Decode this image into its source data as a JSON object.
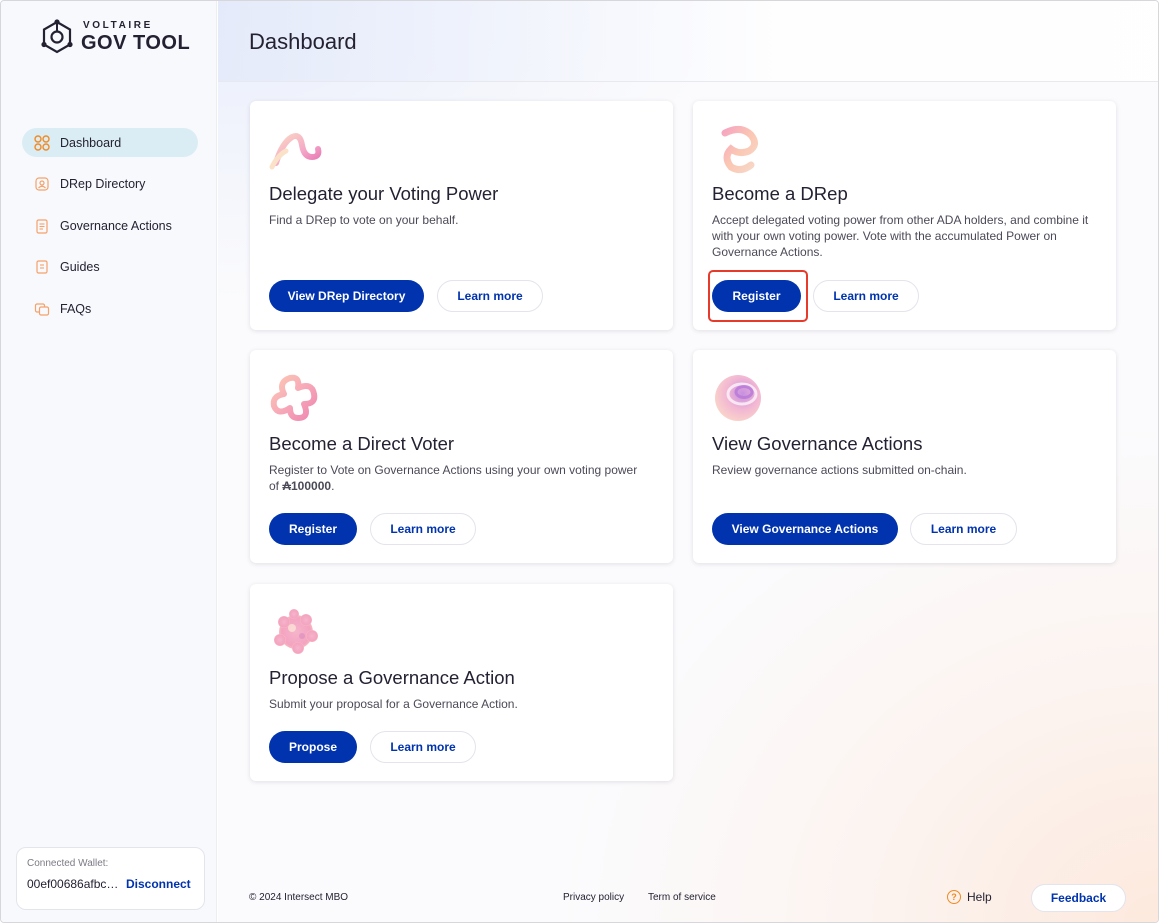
{
  "logo": {
    "small": "VOLTAIRE",
    "big": "GOV TOOL"
  },
  "sidebar": {
    "items": [
      {
        "label": "Dashboard",
        "icon": "dashboard-grid-icon",
        "active": true
      },
      {
        "label": "DRep Directory",
        "icon": "drep-directory-icon",
        "active": false
      },
      {
        "label": "Governance Actions",
        "icon": "governance-actions-icon",
        "active": false
      },
      {
        "label": "Guides",
        "icon": "guides-icon",
        "active": false
      },
      {
        "label": "FAQs",
        "icon": "faqs-icon",
        "active": false
      }
    ],
    "wallet": {
      "label": "Connected Wallet:",
      "address": "00ef00686afbc…",
      "disconnect": "Disconnect"
    }
  },
  "header": {
    "title": "Dashboard"
  },
  "cards": {
    "delegate": {
      "title": "Delegate your Voting Power",
      "description": "Find a DRep to vote on your behalf.",
      "primary": "View DRep Directory",
      "secondary": "Learn more"
    },
    "drep": {
      "title": "Become a DRep",
      "description": "Accept delegated voting power from other ADA holders, and combine it with your own voting power. Vote with the accumulated Power on Governance Actions.",
      "primary": "Register",
      "secondary": "Learn more"
    },
    "direct_voter": {
      "title": "Become a Direct Voter",
      "description_line1": "Register to Vote on Governance Actions using your own voting power",
      "description_prefix": "of ",
      "amount": "₳100000",
      "description_suffix": ".",
      "primary": "Register",
      "secondary": "Learn more"
    },
    "governance": {
      "title": "View Governance Actions",
      "description": "Review governance actions submitted on-chain.",
      "primary": "View Governance Actions",
      "secondary": "Learn more"
    },
    "propose": {
      "title": "Propose a Governance Action",
      "description": "Submit your proposal for a Governance Action.",
      "primary": "Propose",
      "secondary": "Learn more"
    }
  },
  "footer": {
    "copyright": "© 2024 Intersect MBO",
    "privacy": "Privacy policy",
    "terms": "Term of service",
    "help": "Help",
    "feedback": "Feedback"
  },
  "colors": {
    "primary": "#0033ad",
    "active_nav": "#dbedf4",
    "highlight": "#e63a2a"
  }
}
